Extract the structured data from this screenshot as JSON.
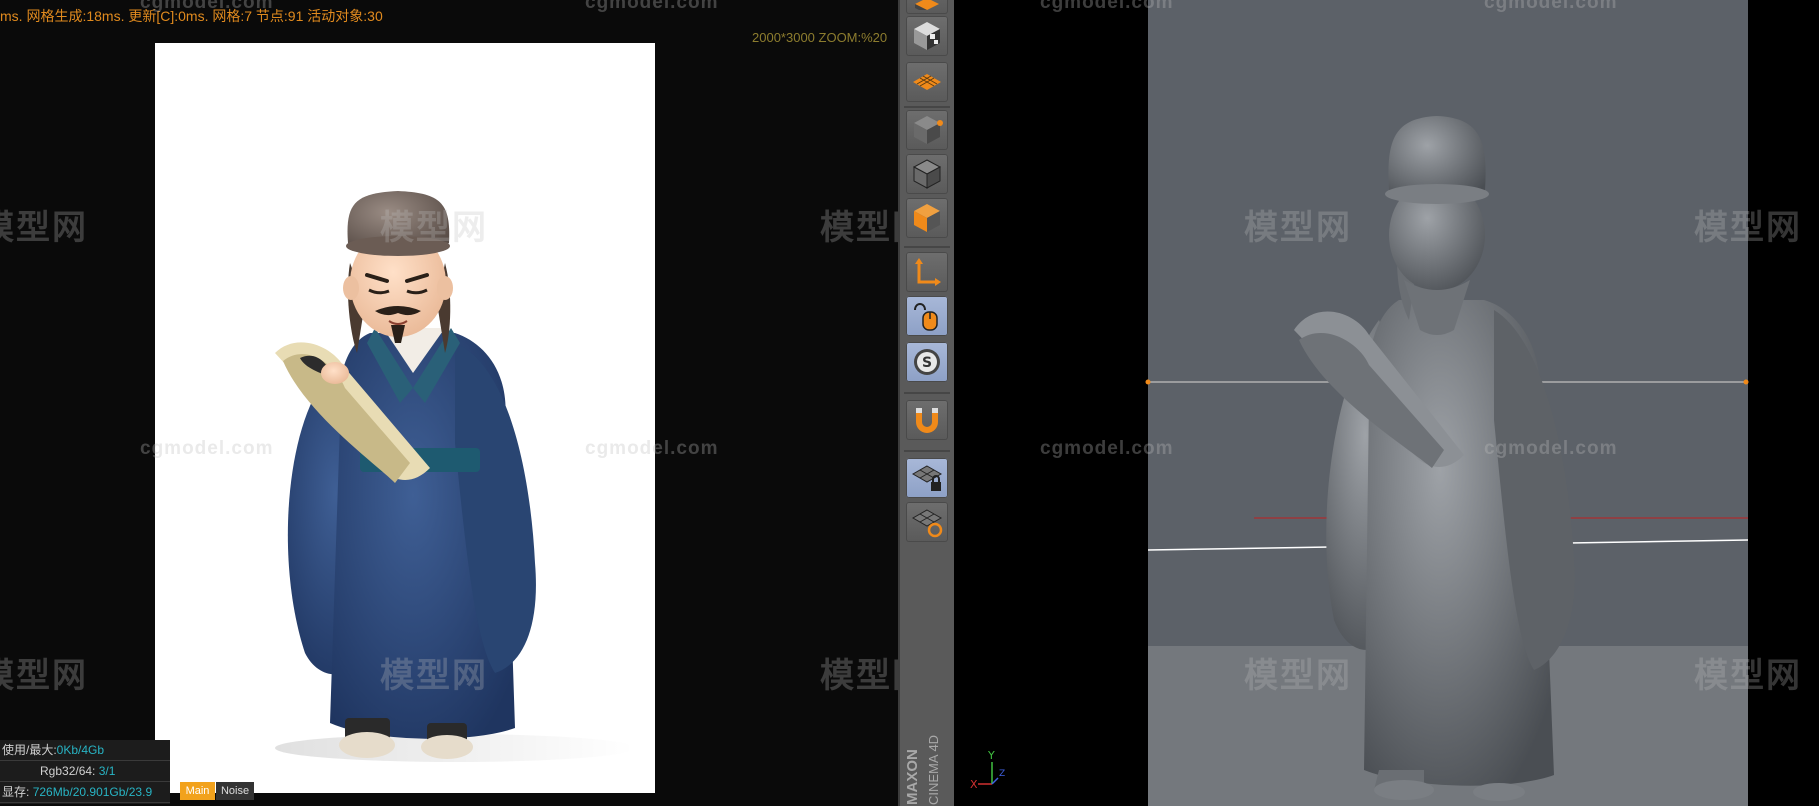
{
  "render_view": {
    "stats_text": "ms. 网格生成:18ms. 更新[C]:0ms. 网格:7 节点:91 活动对象:30",
    "resolution_text": "2000*3000 ZOOM:%20",
    "watermarks": {
      "cn": "模型网",
      "url": "cgmodel.com"
    },
    "memory": {
      "row1_label": "使用/最大:",
      "row1_value": "0Kb/4Gb",
      "row2_label": "Rgb32/64:",
      "row2_value": "3/1",
      "row3_label": "显存:",
      "row3_value": "726Mb/20.901Gb/23.9"
    },
    "tabs": {
      "main": "Main",
      "noise": "Noise"
    }
  },
  "toolbar": {
    "tools": [
      {
        "icon": "cube-top-icon"
      },
      {
        "icon": "checker-cube-icon"
      },
      {
        "icon": "grid-plane-icon"
      },
      {
        "icon": "cube-points-icon"
      },
      {
        "icon": "cube-edges-icon"
      },
      {
        "icon": "cube-polygons-icon"
      },
      {
        "icon": "axis-icon"
      },
      {
        "icon": "mouse-icon",
        "active": true
      },
      {
        "icon": "snap-s-icon",
        "active": true
      },
      {
        "icon": "magnet-icon"
      },
      {
        "icon": "lock-grid-icon",
        "active": true
      },
      {
        "icon": "refresh-grid-icon"
      }
    ],
    "brand_maxon": "MAXON",
    "brand_product": "CINEMA 4D"
  },
  "viewport": {
    "axis_x": "X",
    "axis_y": "Y",
    "axis_z": "Z"
  },
  "colors": {
    "stats_orange": "#e08a1e",
    "accent_active_tool": "#8da0c6",
    "memory_value": "#28b4c4",
    "tab_main": "#f2a21c",
    "robe_blue": "#2e4a7a",
    "viewport_gray": "#5c6168"
  }
}
